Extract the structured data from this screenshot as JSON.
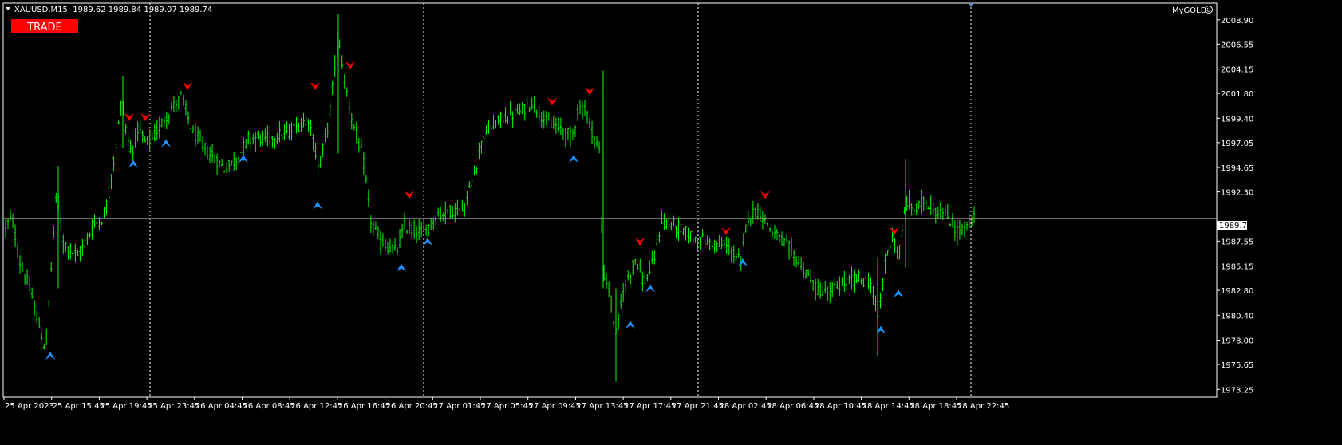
{
  "header": {
    "symbol_line": "XAUUSD,M15  1989.62 1989.84 1989.07 1989.74",
    "indicator_name": "MyGOLD",
    "smiley_icon": "smiley-face-icon"
  },
  "trade_button": {
    "label": "TRADE",
    "color": "#ff0000"
  },
  "colors": {
    "background": "#000000",
    "candle": "#00ff00",
    "axis": "#ffffff",
    "grid_separator": "#ffffff",
    "current_price_line": "#a9a9a9",
    "current_price_label_bg": "#ffffff",
    "current_price_label_text": "#000000",
    "sell_arrow": "#ff0000",
    "buy_arrow": "#1e90ff"
  },
  "icons": {
    "dropdown": "dropdown-triangle-icon",
    "sell_arrow": "sell-arrow-icon",
    "buy_arrow": "buy-arrow-icon"
  },
  "chart_data": {
    "type": "candlestick",
    "symbol": "XAUUSD",
    "timeframe": "M15",
    "current_price": 1989.74,
    "current_price_label": "1989.74",
    "ylim": [
      1972.5,
      2010.5
    ],
    "y_ticks": [
      "2008.90",
      "2006.55",
      "2004.15",
      "2001.80",
      "1999.40",
      "1997.05",
      "1994.65",
      "1992.30",
      "1987.55",
      "1985.15",
      "1982.80",
      "1980.40",
      "1978.00",
      "1975.65",
      "1973.25"
    ],
    "x_tick_labels": [
      "25 Apr 2023",
      "25 Apr 15:45",
      "25 Apr 19:45",
      "25 Apr 23:45",
      "26 Apr 04:45",
      "26 Apr 08:45",
      "26 Apr 12:45",
      "26 Apr 16:45",
      "26 Apr 20:45",
      "27 Apr 01:45",
      "27 Apr 05:45",
      "27 Apr 09:45",
      "27 Apr 13:45",
      "27 Apr 17:45",
      "27 Apr 21:45",
      "28 Apr 02:45",
      "28 Apr 06:45",
      "28 Apr 10:45",
      "28 Apr 14:45",
      "28 Apr 18:45",
      "28 Apr 22:45"
    ],
    "bar_count": 404,
    "price_path": [
      [
        0,
        1989.0
      ],
      [
        8,
        1989.8
      ],
      [
        18,
        1985.5
      ],
      [
        30,
        1983.0
      ],
      [
        45,
        1978.5
      ],
      [
        50,
        1977.0
      ],
      [
        56,
        1983.5
      ],
      [
        64,
        1992.5
      ],
      [
        72,
        1987.5
      ],
      [
        90,
        1986.0
      ],
      [
        110,
        1989.0
      ],
      [
        125,
        1990.0
      ],
      [
        138,
        1996.5
      ],
      [
        146,
        2001.5
      ],
      [
        152,
        1997.5
      ],
      [
        158,
        1996.0
      ],
      [
        166,
        1998.5
      ],
      [
        175,
        1997.0
      ],
      [
        185,
        1997.5
      ],
      [
        200,
        1999.5
      ],
      [
        220,
        2001.5
      ],
      [
        235,
        1998.0
      ],
      [
        255,
        1996.0
      ],
      [
        275,
        1994.5
      ],
      [
        290,
        1995.5
      ],
      [
        305,
        1997.5
      ],
      [
        330,
        1997.5
      ],
      [
        355,
        1998.0
      ],
      [
        380,
        1999.5
      ],
      [
        392,
        1994.5
      ],
      [
        405,
        1999.0
      ],
      [
        417,
        2007.5
      ],
      [
        425,
        2003.0
      ],
      [
        435,
        1999.0
      ],
      [
        448,
        1995.5
      ],
      [
        458,
        1989.5
      ],
      [
        470,
        1987.5
      ],
      [
        490,
        1986.5
      ],
      [
        500,
        1989.0
      ],
      [
        512,
        1988.5
      ],
      [
        525,
        1988.5
      ],
      [
        540,
        1990.0
      ],
      [
        555,
        1990.5
      ],
      [
        575,
        1990.5
      ],
      [
        590,
        1995.0
      ],
      [
        600,
        1998.0
      ],
      [
        625,
        1999.5
      ],
      [
        645,
        2000.0
      ],
      [
        660,
        2001.0
      ],
      [
        678,
        1999.0
      ],
      [
        695,
        1998.5
      ],
      [
        710,
        1997.5
      ],
      [
        718,
        2000.5
      ],
      [
        728,
        2000.0
      ],
      [
        738,
        1997.5
      ],
      [
        744,
        1996.5
      ],
      [
        749,
        1984.5
      ],
      [
        756,
        1983.0
      ],
      [
        765,
        1978.5
      ],
      [
        775,
        1983.0
      ],
      [
        790,
        1986.0
      ],
      [
        800,
        1983.5
      ],
      [
        812,
        1985.5
      ],
      [
        822,
        1989.5
      ],
      [
        840,
        1989.0
      ],
      [
        860,
        1988.0
      ],
      [
        880,
        1987.5
      ],
      [
        905,
        1987.0
      ],
      [
        922,
        1985.5
      ],
      [
        930,
        1990.0
      ],
      [
        945,
        1990.5
      ],
      [
        960,
        1988.5
      ],
      [
        980,
        1987.0
      ],
      [
        1000,
        1985.0
      ],
      [
        1015,
        1983.0
      ],
      [
        1030,
        1982.5
      ],
      [
        1050,
        1983.5
      ],
      [
        1070,
        1984.0
      ],
      [
        1085,
        1983.5
      ],
      [
        1093,
        1980.0
      ],
      [
        1103,
        1985.5
      ],
      [
        1112,
        1988.5
      ],
      [
        1120,
        1985.5
      ],
      [
        1128,
        1991.5
      ],
      [
        1140,
        1990.5
      ],
      [
        1152,
        1991.5
      ],
      [
        1165,
        1990.5
      ],
      [
        1180,
        1990.0
      ],
      [
        1192,
        1988.5
      ],
      [
        1205,
        1989.0
      ],
      [
        1214,
        1989.74
      ]
    ],
    "sell_arrow_positions": [
      [
        155,
        1999.5
      ],
      [
        175,
        1999.5
      ],
      [
        228,
        2002.5
      ],
      [
        388,
        2002.5
      ],
      [
        432,
        2004.5
      ],
      [
        506,
        1992.0
      ],
      [
        685,
        2001.0
      ],
      [
        732,
        2002.0
      ],
      [
        795,
        1987.5
      ],
      [
        903,
        1988.5
      ],
      [
        952,
        1992.0
      ],
      [
        1114,
        1988.5
      ]
    ],
    "buy_arrow_positions": [
      [
        56,
        1976.5
      ],
      [
        160,
        1995.0
      ],
      [
        201,
        1997.0
      ],
      [
        298,
        1995.5
      ],
      [
        391,
        1991.0
      ],
      [
        496,
        1985.0
      ],
      [
        529,
        1987.5
      ],
      [
        712,
        1995.5
      ],
      [
        808,
        1983.0
      ],
      [
        783,
        1979.5
      ],
      [
        924,
        1985.5
      ],
      [
        1097,
        1979.0
      ],
      [
        1119,
        1982.5
      ]
    ],
    "period_separators_after_labels": [
      "25 Apr 19:45",
      "26 Apr 20:45",
      "27 Apr 17:45",
      "28 Apr 22:45"
    ]
  }
}
